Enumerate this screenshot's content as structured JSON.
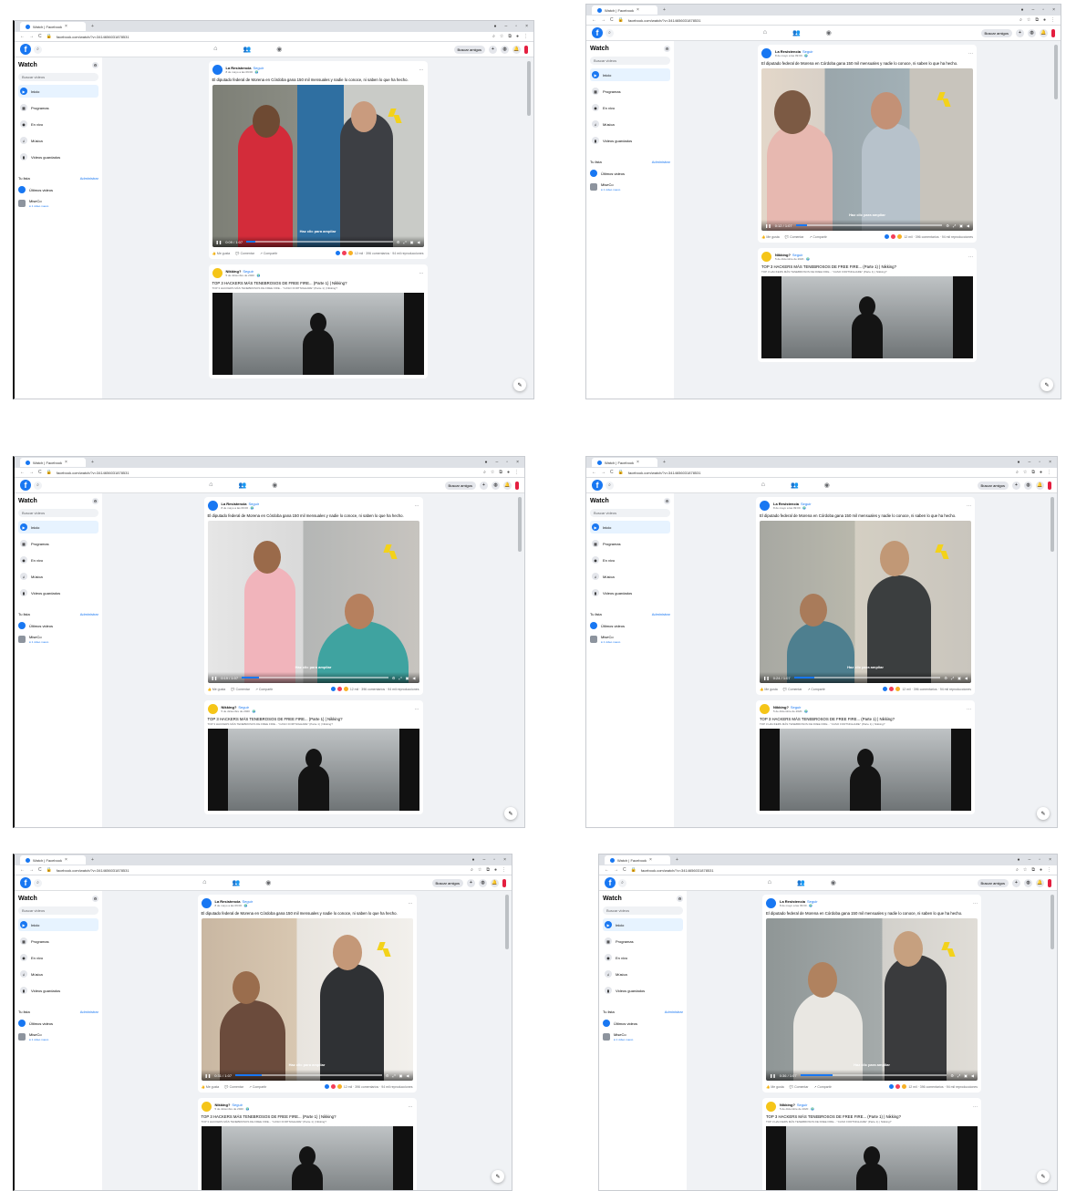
{
  "browser": {
    "tab_title": "Watch | Facebook",
    "url": "facebook.com/watch/?v=3414656031878531"
  },
  "nav": {
    "find_friends": "Buscar amigos"
  },
  "sidebar": {
    "title": "Watch",
    "search_placeholder": "Buscar videos",
    "items": [
      {
        "label": "Inicio",
        "icon": "home-icon"
      },
      {
        "label": "Programas",
        "icon": "shows-icon"
      },
      {
        "label": "En vivo",
        "icon": "live-icon"
      },
      {
        "label": "Música",
        "icon": "music-icon"
      },
      {
        "label": "Videos guardados",
        "icon": "saved-icon"
      }
    ],
    "list_title": "Tu lista",
    "list_admin": "Administrar",
    "list_items": [
      {
        "name": "Últimos videos",
        "sub": ""
      },
      {
        "name": "MiseCo",
        "sub": "● 1 video nuevo"
      }
    ]
  },
  "post1": {
    "author": "La Resistencia",
    "follow": "Seguir",
    "date": "8 de mayo a las 09:00 · 🌍",
    "title": "El diputado federal de Morena en Córdoba gana 150 mil mensuales y nadie lo conoce, ni saben lo que ha hecho.",
    "enlarge": "Haz clic para ampliar",
    "actions": {
      "like": "Me gusta",
      "comment": "Comentar",
      "share": "Compartir"
    },
    "stats": "12 mil · 396 comentarios · 94 mil reproducciones"
  },
  "post2": {
    "author": "Nikking?",
    "follow": "Seguir",
    "date": "5 de diciembre de 2020 · 🌍",
    "title": "TOP 3 HACKERS MÁS TENEBROSOS DE FREE FIRE... (Parte 1) | Nikking?",
    "subtitle": "TOP 3 HACKERS MÁS TENEBROSOS DE FREE FIRE... \"CASO FORTNIGHARE\" (Parte 1) | Nikking?"
  },
  "frames": [
    {
      "time": "0:09 / 1:07",
      "progress": 0.06
    },
    {
      "time": "0:12 / 1:07",
      "progress": 0.08
    },
    {
      "time": "0:19 / 1:07",
      "progress": 0.12
    },
    {
      "time": "0:24 / 1:07",
      "progress": 0.14
    },
    {
      "time": "0:31 / 1:07",
      "progress": 0.18
    },
    {
      "time": "0:36 / 1:07",
      "progress": 0.22
    }
  ],
  "colors": {
    "accent": "#1877f2",
    "background": "#f0f2f5",
    "logo_yellow": "#f3d21a"
  }
}
